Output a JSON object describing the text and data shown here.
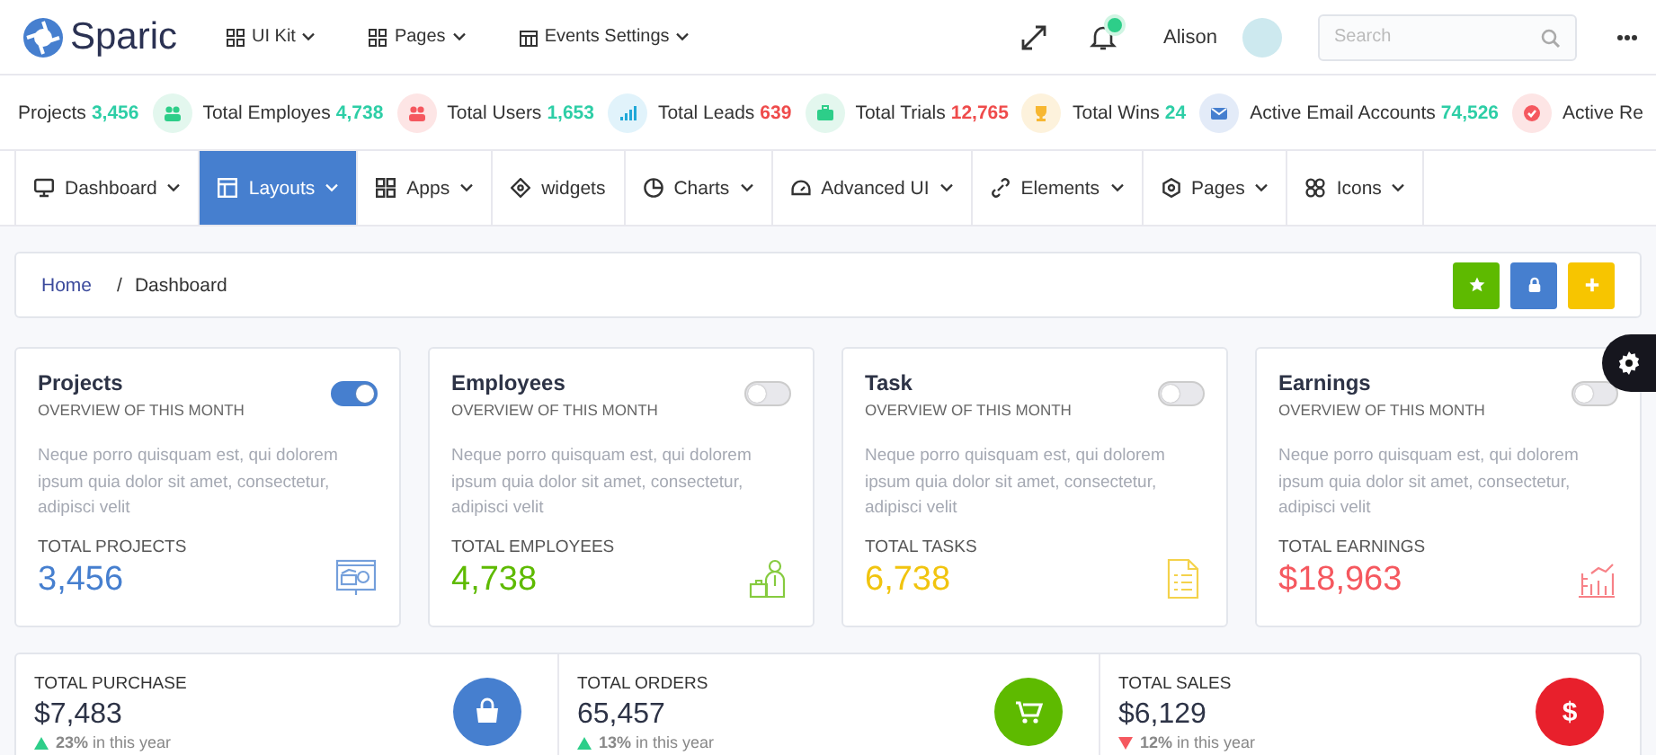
{
  "header": {
    "logo": "Sparic",
    "menus": [
      {
        "label": "UI Kit",
        "kind": "grid"
      },
      {
        "label": "Pages",
        "kind": "grid"
      },
      {
        "label": "Events Settings",
        "kind": "calendar"
      }
    ],
    "notification_dot": true,
    "user": "Alison",
    "search": {
      "placeholder": "Search"
    }
  },
  "ticker": [
    {
      "label": "Projects",
      "value": "3,456",
      "color": "#2dcea6",
      "kind": "none"
    },
    {
      "label": "Total Employes",
      "value": "4,738",
      "color": "#2dcea6",
      "kind": "users"
    },
    {
      "label": "Total Users",
      "value": "1,653",
      "color": "#2dcea6",
      "kind": "team"
    },
    {
      "label": "Total Leads",
      "value": "639",
      "color": "#ef4b4b",
      "kind": "signal"
    },
    {
      "label": "Total Trials",
      "value": "12,765",
      "color": "#ef4b4b",
      "kind": "briefcase"
    },
    {
      "label": "Total Wins",
      "value": "24",
      "color": "#2dcea6",
      "kind": "trophy"
    },
    {
      "label": "Active Email Accounts",
      "value": "74,526",
      "color": "#2dcea6",
      "kind": "mail"
    },
    {
      "label": "Active Re",
      "kind": "check"
    }
  ],
  "nav": [
    {
      "label": "Dashboard",
      "kind": "monitor",
      "caret": true,
      "selected": false
    },
    {
      "label": "Layouts",
      "kind": "layout",
      "caret": true,
      "selected": true
    },
    {
      "label": "Apps",
      "kind": "grid",
      "caret": true,
      "selected": false
    },
    {
      "label": "widgets",
      "kind": "diamond",
      "caret": false,
      "selected": false
    },
    {
      "label": "Charts",
      "kind": "pie",
      "caret": true,
      "selected": false
    },
    {
      "label": "Advanced UI",
      "kind": "gauge",
      "caret": true,
      "selected": false
    },
    {
      "label": "Elements",
      "kind": "link",
      "caret": true,
      "selected": false
    },
    {
      "label": "Pages",
      "kind": "hex",
      "caret": true,
      "selected": false
    },
    {
      "label": "Icons",
      "kind": "clover",
      "caret": true,
      "selected": false
    }
  ],
  "breadcrumb": {
    "items": [
      "Home",
      "Dashboard"
    ],
    "separator": "/",
    "buttons": [
      {
        "kind": "star"
      },
      {
        "kind": "lock"
      },
      {
        "kind": "plus"
      }
    ]
  },
  "cards": [
    {
      "title": "Projects",
      "subtitle": "OVERVIEW OF THIS MONTH",
      "text": "Neque porro quisquam est, qui dolorem ipsum quia dolor sit amet, consectetur, adipisci velit",
      "total_label": "TOTAL PROJECTS",
      "total": "3,456",
      "color": "#467fcf",
      "on": true,
      "kind": "presentation"
    },
    {
      "title": "Employees",
      "subtitle": "OVERVIEW OF THIS MONTH",
      "text": "Neque porro quisquam est, qui dolorem ipsum quia dolor sit amet, consectetur, adipisci velit",
      "total_label": "TOTAL EMPLOYEES",
      "total": "4,738",
      "color": "#5eba00",
      "on": false,
      "kind": "person"
    },
    {
      "title": "Task",
      "subtitle": "OVERVIEW OF THIS MONTH",
      "text": "Neque porro quisquam est, qui dolorem ipsum quia dolor sit amet, consectetur, adipisci velit",
      "total_label": "TOTAL TASKS",
      "total": "6,738",
      "color": "#f1c40f",
      "on": false,
      "kind": "document"
    },
    {
      "title": "Earnings",
      "subtitle": "OVERVIEW OF THIS MONTH",
      "text": "Neque porro quisquam est, qui dolorem ipsum quia dolor sit amet, consectetur, adipisci velit",
      "total_label": "TOTAL EARNINGS",
      "total": "$18,963",
      "color": "#f5585f",
      "on": false,
      "kind": "bars"
    }
  ],
  "summary": [
    {
      "label": "TOTAL PURCHASE",
      "value": "$7,483",
      "trend": "23%",
      "trend_text": "in this year",
      "rising": true,
      "kind": "bag"
    },
    {
      "label": "TOTAL ORDERS",
      "value": "65,457",
      "trend": "13%",
      "trend_text": "in this year",
      "rising": true,
      "kind": "cart"
    },
    {
      "label": "TOTAL SALES",
      "value": "$6,129",
      "trend": "12%",
      "trend_text": "in this year",
      "rising": false,
      "kind": "dollar",
      "glyph": "$"
    }
  ]
}
